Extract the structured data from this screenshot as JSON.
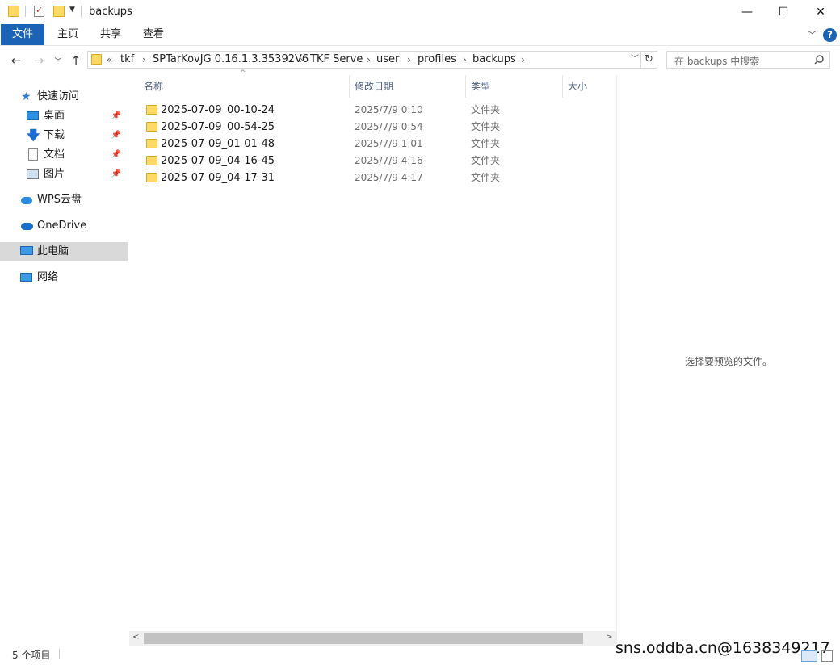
{
  "window": {
    "title": "backups",
    "controls": {
      "minimize": "—",
      "maximize": "☐",
      "close": "✕"
    }
  },
  "ribbon": {
    "tabs": [
      "文件",
      "主页",
      "共享",
      "查看"
    ],
    "help_icon": "?"
  },
  "nav": {
    "breadcrumbs": [
      "tkf",
      "SPTarKovJG 0.16.1.3.35392V6",
      "TKF Serve",
      "user",
      "profiles",
      "backups"
    ],
    "overflow": "«",
    "search_placeholder": "在 backups 中搜索"
  },
  "sidebar": {
    "quick_access": "快速访问",
    "quick_items": [
      "桌面",
      "下载",
      "文档",
      "图片"
    ],
    "wps": "WPS云盘",
    "onedrive": "OneDrive",
    "this_pc": "此电脑",
    "network": "网络"
  },
  "columns": {
    "name": "名称",
    "date": "修改日期",
    "type": "类型",
    "size": "大小"
  },
  "files": [
    {
      "name": "2025-07-09_00-10-24",
      "date": "2025/7/9 0:10",
      "type": "文件夹"
    },
    {
      "name": "2025-07-09_00-54-25",
      "date": "2025/7/9 0:54",
      "type": "文件夹"
    },
    {
      "name": "2025-07-09_01-01-48",
      "date": "2025/7/9 1:01",
      "type": "文件夹"
    },
    {
      "name": "2025-07-09_04-16-45",
      "date": "2025/7/9 4:16",
      "type": "文件夹"
    },
    {
      "name": "2025-07-09_04-17-31",
      "date": "2025/7/9 4:17",
      "type": "文件夹"
    }
  ],
  "preview_text": "选择要预览的文件。",
  "status": "5 个项目",
  "watermark": "sns.oddba.cn@1638349217",
  "colors": {
    "accent": "#1a63b5",
    "folder": "#ffd966",
    "selected": "#d9d9d9"
  }
}
